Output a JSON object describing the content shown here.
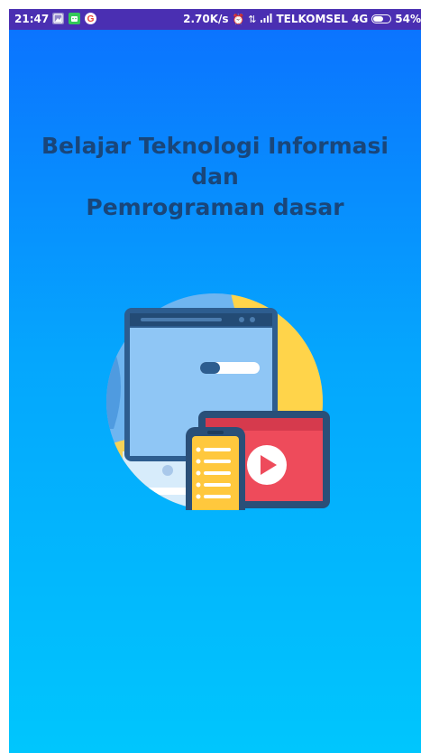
{
  "status_bar": {
    "time": "21:47",
    "network_speed": "2.70K/s",
    "carrier": "TELKOMSEL 4G",
    "battery": "54%",
    "icons": [
      "gallery-icon",
      "android-icon",
      "google-icon",
      "alarm-icon",
      "data-arrows-icon",
      "signal-icon",
      "battery-icon"
    ],
    "background_color": "#4a2fb2"
  },
  "headline": {
    "line1": "Belajar Teknologi Informasi",
    "line2": "dan",
    "line3": "Pemrograman dasar"
  },
  "illustration": {
    "icon": "devices-video-illustration"
  },
  "colors": {
    "gradient_top": "#0b74ff",
    "gradient_bottom": "#00c6fd",
    "headline_text": "#19467a"
  }
}
